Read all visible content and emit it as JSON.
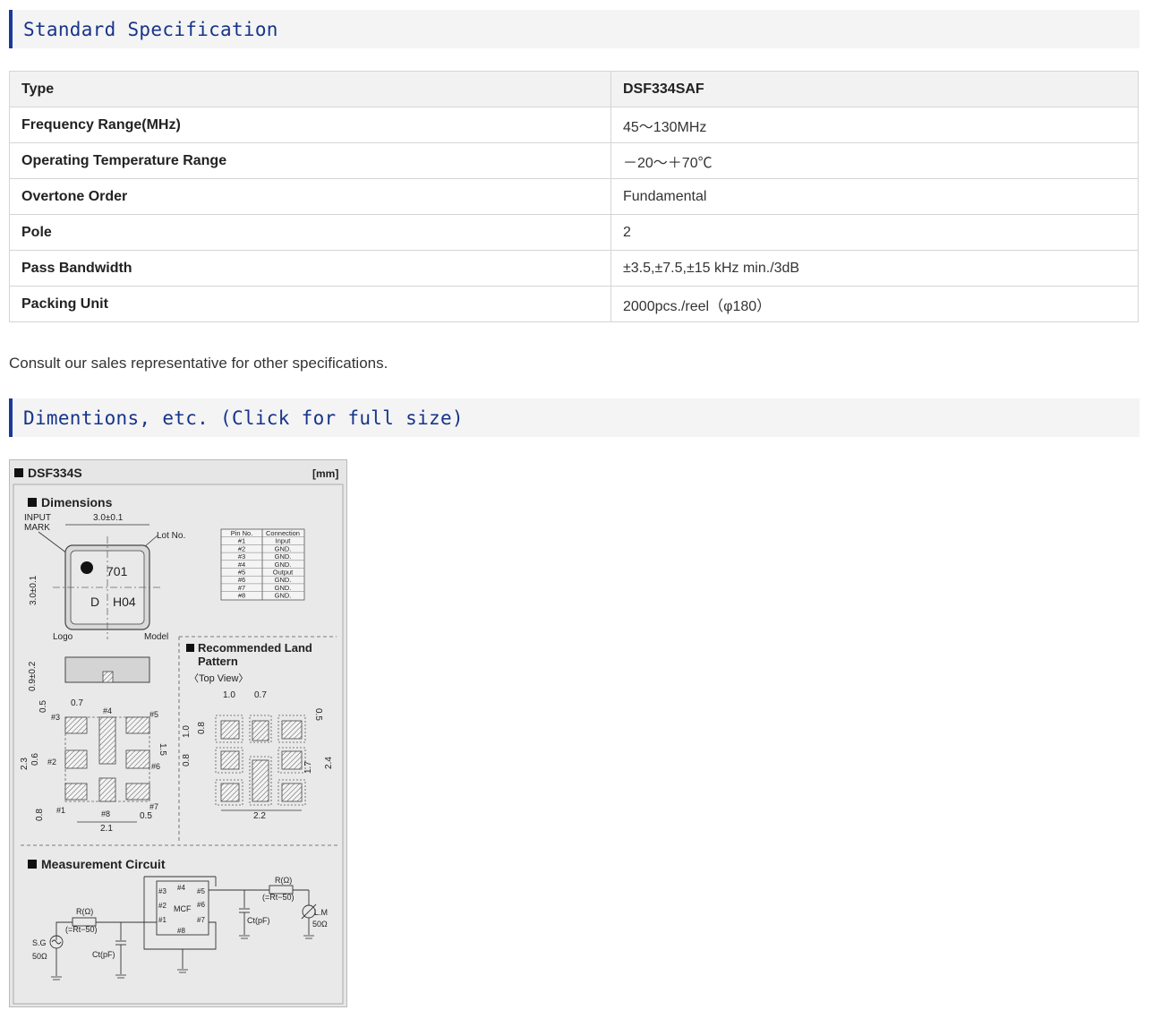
{
  "sections": {
    "spec_title": "Standard Specification",
    "dim_title": "Dimentions, etc. (Click for full size)"
  },
  "spec_table": {
    "rows": [
      {
        "label": "Type",
        "value": "DSF334SAF"
      },
      {
        "label": "Frequency Range(MHz)",
        "value": "45～130MHz"
      },
      {
        "label": "Operating Temperature Range",
        "value": "－20～＋70℃"
      },
      {
        "label": "Overtone Order",
        "value": "Fundamental"
      },
      {
        "label": "Pole",
        "value": "2"
      },
      {
        "label": "Pass Bandwidth",
        "value": "±3.5,±7.5,±15 kHz min./3dB"
      },
      {
        "label": "Packing Unit",
        "value": "2000pcs./reel（φ180）"
      }
    ]
  },
  "note": "Consult our sales representative for other specifications.",
  "drawing": {
    "model": "DSF334S",
    "unit": "[mm]",
    "dimensions_heading": "Dimensions",
    "input_mark": [
      "INPUT",
      "MARK"
    ],
    "width_dim": "3.0±0.1",
    "height_dim": "3.0±0.1",
    "lot_no": "Lot No.",
    "lot_code": "701",
    "mark_d": "D",
    "mark_model": "H04",
    "logo": "Logo",
    "model_label": "Model",
    "thickness": "0.9±0.2",
    "pin_table": {
      "headers": [
        "Pin No.",
        "Connection"
      ],
      "rows": [
        [
          "#1",
          "Input"
        ],
        [
          "#2",
          "GND."
        ],
        [
          "#3",
          "GND."
        ],
        [
          "#4",
          "GND."
        ],
        [
          "#5",
          "Output"
        ],
        [
          "#6",
          "GND."
        ],
        [
          "#7",
          "GND."
        ],
        [
          "#8",
          "GND."
        ]
      ]
    },
    "bottom_dims": {
      "d07": "0.7",
      "d05_top": "0.5",
      "d15": "1.5",
      "d23": "2.3",
      "d06": "0.6",
      "d08": "0.8",
      "d05_bottom": "0.5",
      "d21": "2.1",
      "pins": [
        "#1",
        "#2",
        "#3",
        "#4",
        "#5",
        "#6",
        "#7",
        "#8"
      ]
    },
    "land_heading": [
      "Recommended Land",
      "Pattern"
    ],
    "top_view": "〈Top View〉",
    "land_dims": {
      "d10_top": "1.0",
      "d07": "0.7",
      "d10_left": "1.0",
      "d08_a": "0.8",
      "d08_b": "0.8",
      "d05": "0.5",
      "d17": "1.7",
      "d24": "2.4",
      "d22": "2.2"
    },
    "circuit_heading": "Measurement Circuit",
    "circuit": {
      "r_top": "R(Ω)",
      "r_top_eq": "(=Rt−50)",
      "r_left": "R(Ω)",
      "r_left_eq": "(=Rt−50)",
      "sg": "S.G",
      "sg_ohm": "50Ω",
      "ct_left": "Ct(pF)",
      "ct_right": "Ct(pF)",
      "lm": "L.M",
      "lm_ohm": "50Ω",
      "mcf": "MCF",
      "pins": [
        "#3",
        "#4",
        "#5",
        "#2",
        "#6",
        "#1",
        "#7",
        "#8"
      ]
    }
  }
}
